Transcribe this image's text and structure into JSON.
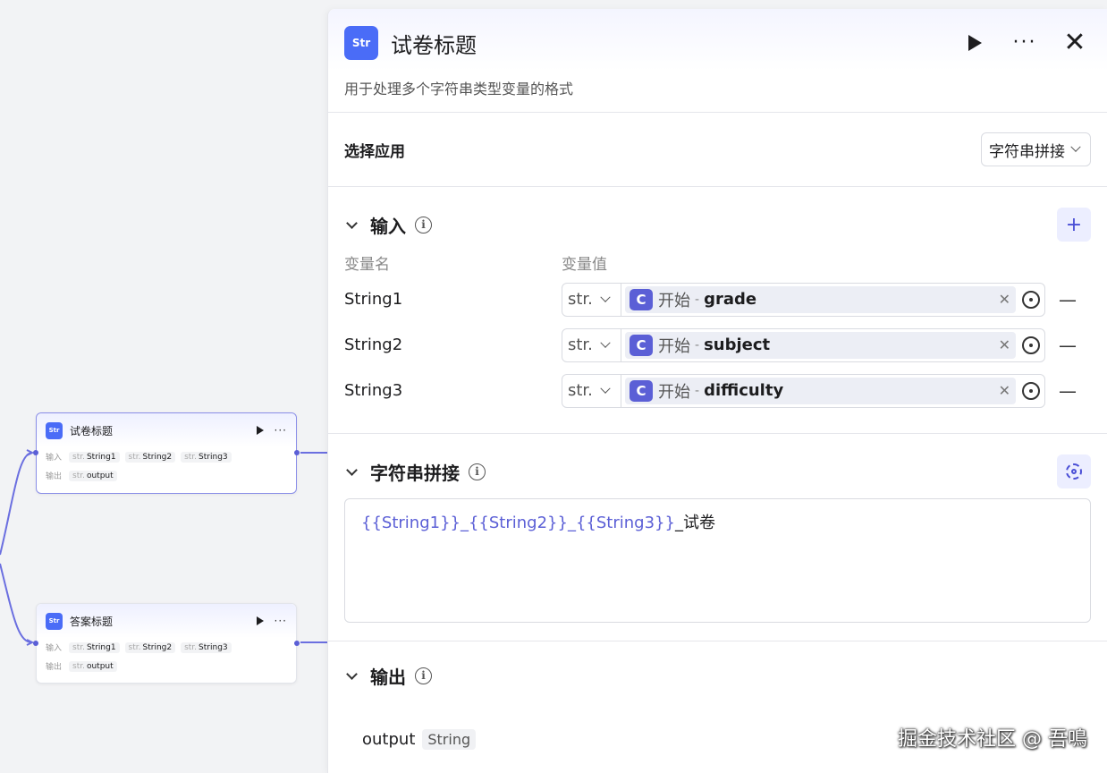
{
  "canvas": {
    "nodes": [
      {
        "title": "试卷标题",
        "input_label": "输入",
        "output_label": "输出",
        "inputs": [
          "String1",
          "String2",
          "String3"
        ],
        "outputs": [
          "output"
        ],
        "type_prefix": "str."
      },
      {
        "title": "答案标题",
        "input_label": "输入",
        "output_label": "输出",
        "inputs": [
          "String1",
          "String2",
          "String3"
        ],
        "outputs": [
          "output"
        ],
        "type_prefix": "str."
      }
    ]
  },
  "panel": {
    "icon_text": "Str",
    "title": "试卷标题",
    "description": "用于处理多个字符串类型变量的格式",
    "select": {
      "label": "选择应用",
      "value": "字符串拼接"
    },
    "input_section": {
      "title": "输入",
      "col_name": "变量名",
      "col_value": "变量值",
      "rows": [
        {
          "name": "String1",
          "type": "str.",
          "ref_node": "开始",
          "sep": "-",
          "ref_var": "grade"
        },
        {
          "name": "String2",
          "type": "str.",
          "ref_node": "开始",
          "sep": "-",
          "ref_var": "subject"
        },
        {
          "name": "String3",
          "type": "str.",
          "ref_node": "开始",
          "sep": "-",
          "ref_var": "difficulty"
        }
      ]
    },
    "concat_section": {
      "title": "字符串拼接",
      "template_vars": "{{String1}}_{{String2}}_{{String3}}",
      "template_suffix": "_试卷"
    },
    "output_section": {
      "title": "输出",
      "name": "output",
      "type": "String"
    }
  },
  "watermark": "掘金技术社区 @ 吾鳴",
  "colors": {
    "accent": "#5b5fd6",
    "app_icon": "#4a6cf7",
    "edge": "#5b5fd6"
  }
}
